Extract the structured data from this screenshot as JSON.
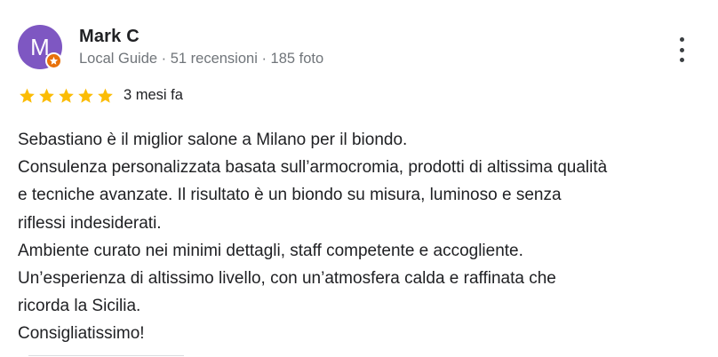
{
  "reviewer": {
    "name": "Mark C",
    "avatar_letter": "M",
    "badge_icon": "local-guide-star-icon",
    "meta": "Local Guide · 51 recensioni · 185 foto"
  },
  "menu": {
    "icon": "more-vert-icon"
  },
  "rating": {
    "stars": 5,
    "max": 5,
    "color": "#fbbc04"
  },
  "time_ago": "3 mesi fa",
  "review_lines": [
    "Sebastiano è il miglior salone a Milano per il biondo.",
    "Consulenza personalizzata basata sull’armocromia, prodotti di altissima qualità",
    "e tecniche avanzate. Il risultato è un biondo su misura, luminoso e senza",
    "riflessi indesiderati.",
    "Ambiente curato nei minimi dettagli, staff competente e accogliente.",
    "Un’esperienza di altissimo livello, con un’atmosfera calda e raffinata che",
    "ricorda la Sicilia.",
    "Consigliatissimo!"
  ],
  "colors": {
    "avatar": "#7e57c2",
    "badge": "#e8710a",
    "text": "#202124",
    "secondary": "#70757a"
  }
}
